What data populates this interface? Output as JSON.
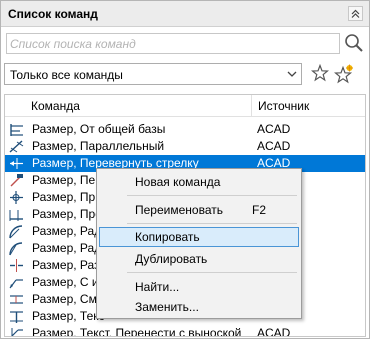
{
  "panel": {
    "title": "Список команд",
    "search_placeholder": "Список поиска команд",
    "filter_value": "Только все команды"
  },
  "list": {
    "columns": {
      "command": "Команда",
      "source": "Источник"
    },
    "rows": [
      {
        "command": "Размер, От общей базы",
        "source": "ACAD"
      },
      {
        "command": "Размер, Параллельный",
        "source": "ACAD"
      },
      {
        "command": "Размер, Перевернуть стрелку",
        "source": "ACAD",
        "selected": true
      },
      {
        "command": "Размер, Пере",
        "source": ""
      },
      {
        "command": "Размер, Прик",
        "source": ""
      },
      {
        "command": "Размер, Прод",
        "source": ""
      },
      {
        "command": "Размер, Ради",
        "source": ""
      },
      {
        "command": "Размер, Ради",
        "source": ""
      },
      {
        "command": "Размер, Разр",
        "source": ""
      },
      {
        "command": "Размер, С из",
        "source": ""
      },
      {
        "command": "Размер, Смещ",
        "source": ""
      },
      {
        "command": "Размер, Текс",
        "source": ""
      },
      {
        "command": "Размер, Текст, Перенести с выноской",
        "source": "ACAD"
      }
    ]
  },
  "context_menu": {
    "items": [
      {
        "label": "Новая команда",
        "shortcut": ""
      },
      {
        "label": "Переименовать",
        "shortcut": "F2"
      },
      {
        "label": "Копировать",
        "shortcut": ""
      },
      {
        "label": "Дублировать",
        "shortcut": ""
      },
      {
        "label": "Найти...",
        "shortcut": ""
      },
      {
        "label": "Заменить...",
        "shortcut": ""
      }
    ]
  }
}
